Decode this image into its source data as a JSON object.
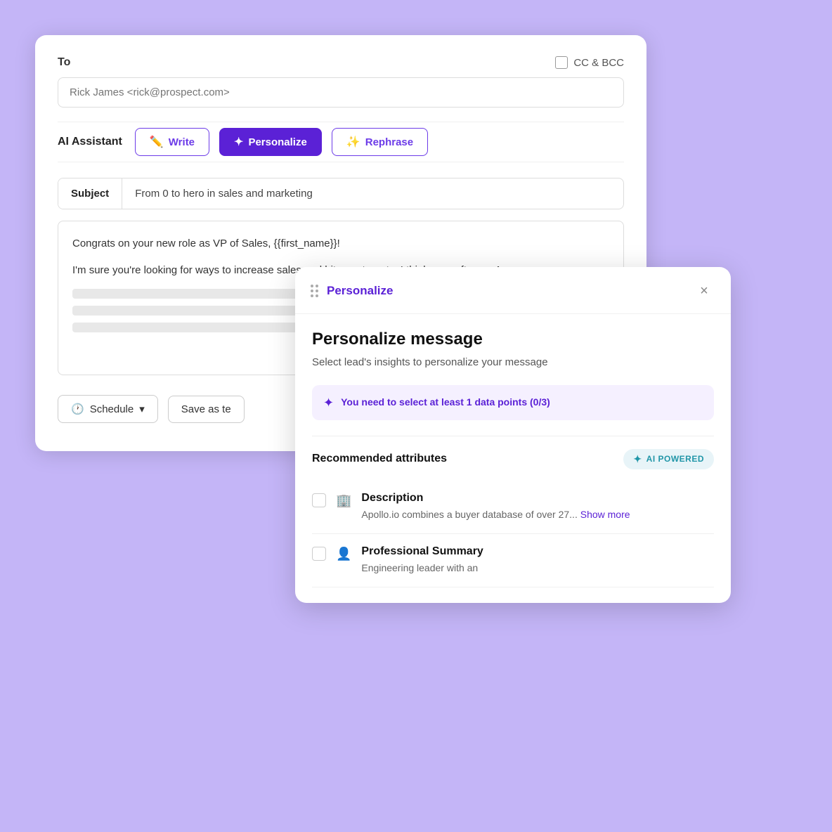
{
  "page": {
    "background_color": "#c4b5f7"
  },
  "email_card": {
    "to_label": "To",
    "cc_bcc_label": "CC & BCC",
    "to_placeholder": "Rick James <rick@prospect.com>",
    "ai_assistant_label": "AI Assistant",
    "buttons": {
      "write": "Write",
      "personalize": "Personalize",
      "rephrase": "Rephrase"
    },
    "subject_label": "Subject",
    "subject_value": "From 0 to hero in sales and marketing",
    "body_text1": "Congrats on your new role as VP of Sales, {{first_name}}!",
    "body_text2": "I'm sure you're looking for ways to increase sales and hit your targets. I think our software, Apo...",
    "toolbar": {
      "schedule_label": "Schedule",
      "save_template_label": "Save as te"
    }
  },
  "personalize_panel": {
    "title": "Personalize",
    "drag_handle": "drag",
    "close_icon": "×",
    "main_title": "Personalize message",
    "subtitle": "Select lead's insights to personalize your message",
    "warning": {
      "text": "You need to select at least 1 data points (0/3)"
    },
    "attributes_section": {
      "title": "Recommended attributes",
      "ai_badge": "AI POWERED",
      "items": [
        {
          "name": "Description",
          "icon": "🏢",
          "desc": "Apollo.io combines a buyer database of over 27...",
          "show_more": "Show more"
        },
        {
          "name": "Professional Summary",
          "icon": "👤",
          "desc": "Engineering leader with an"
        }
      ]
    }
  }
}
